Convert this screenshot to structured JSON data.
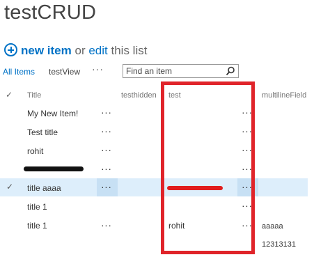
{
  "page": {
    "title": "testCRUD"
  },
  "toolbar": {
    "new_item": "new item",
    "or": "or",
    "edit": "edit",
    "this_list": "this list"
  },
  "views": {
    "all_items": "All Items",
    "test_view": "testView",
    "more": "···"
  },
  "search": {
    "placeholder": "Find an item"
  },
  "columns": {
    "check": "✓",
    "title": "Title",
    "testhidden": "testhidden",
    "test": "test",
    "multiline": "multilineField"
  },
  "rows": [
    {
      "title": "My New Item!",
      "test": "",
      "multiline": "",
      "selected": false
    },
    {
      "title": "Test title",
      "test": "",
      "multiline": "",
      "selected": false
    },
    {
      "title": "rohit",
      "test": "",
      "multiline": "",
      "selected": false
    },
    {
      "title": "",
      "redacted_title": true,
      "test": "",
      "multiline": "",
      "selected": false
    },
    {
      "title": "title aaaa",
      "test": "",
      "redacted_test": true,
      "multiline": "",
      "selected": true
    },
    {
      "title": "title 1",
      "test": "",
      "multiline": "",
      "selected": false
    },
    {
      "title": "title 1",
      "test": "rohit",
      "multiline": "aaaaa",
      "multiline_line2": "12313131",
      "selected": false
    }
  ],
  "ellipsis": "···",
  "colors": {
    "accent": "#0072c6",
    "highlight": "#e0242a",
    "selected_row": "#ddeefb"
  }
}
